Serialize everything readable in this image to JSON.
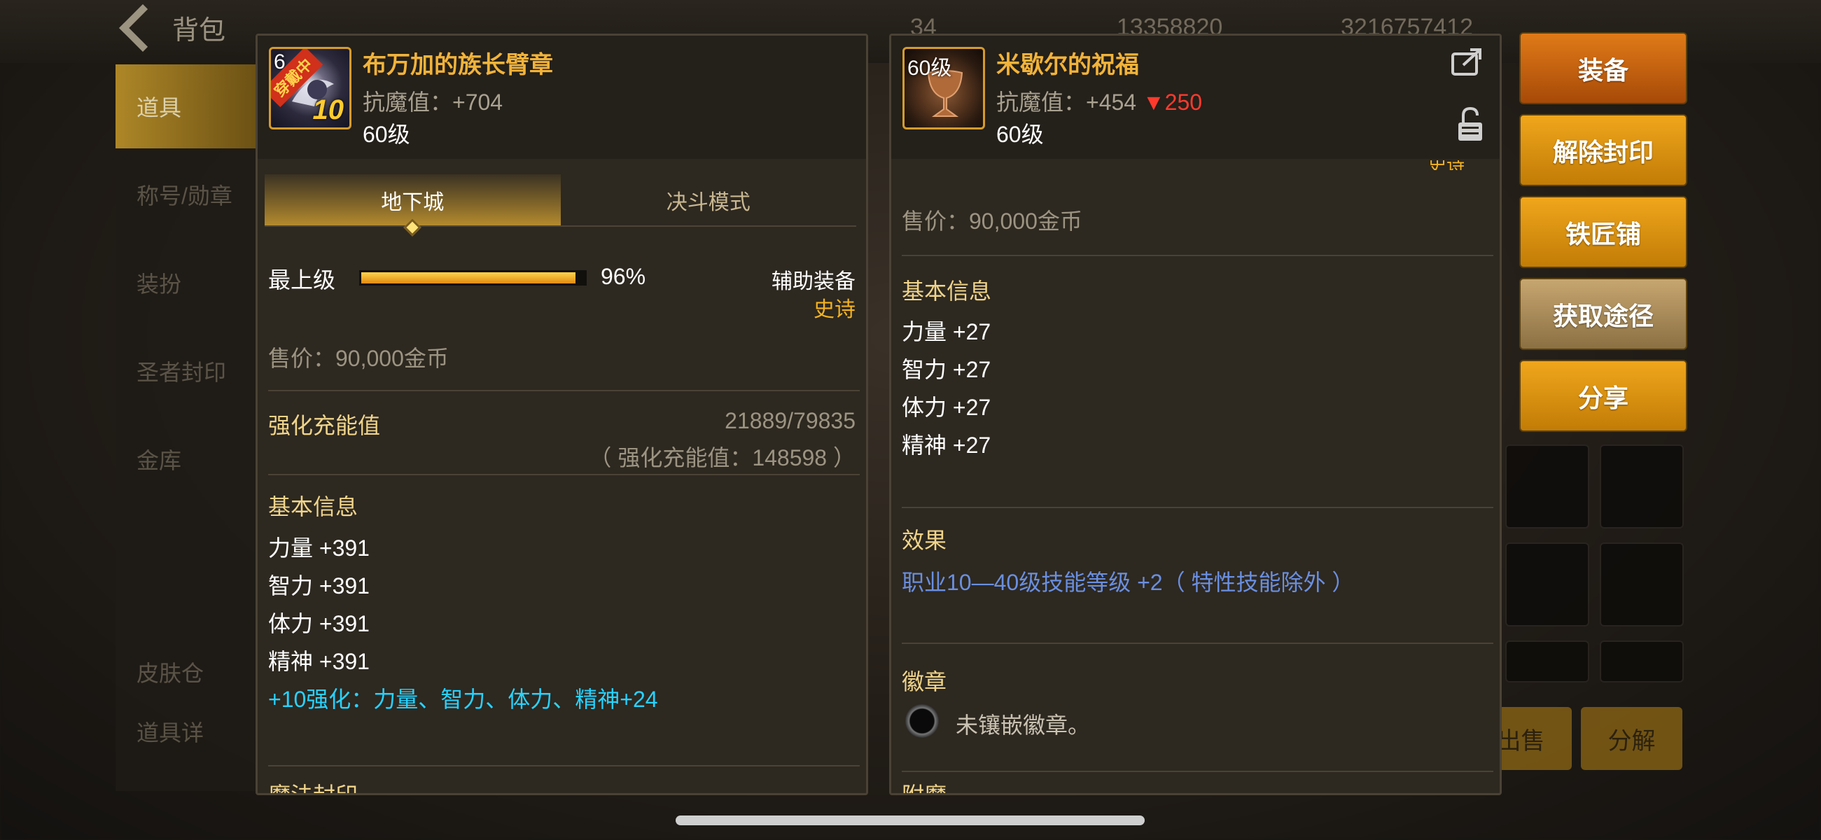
{
  "background": {
    "back_label": "背包",
    "top_stats": [
      "34",
      "13358820",
      "3216757412"
    ],
    "sidebar_items": [
      "道具",
      "称号/勋章",
      "装扮",
      "圣者封印",
      "金库"
    ],
    "bottom_labels": [
      "皮肤仓",
      "道具详"
    ],
    "bottom_buttons": [
      "出售",
      "分解"
    ]
  },
  "left_panel": {
    "icon": {
      "level_tag": "6",
      "equipped_badge": "穿戴中",
      "enhance": "10"
    },
    "name": "布万加的族长臂章",
    "stat": "抗魔值：+704",
    "level": "60级",
    "tabs": [
      {
        "label": "地下城",
        "active": true
      },
      {
        "label": "决斗模式",
        "active": false
      }
    ],
    "grade": {
      "label": "最上级",
      "percent": 96,
      "percent_text": "96%"
    },
    "category": "辅助装备",
    "rarity": "史诗",
    "price": "售价：90,000金币",
    "charge": {
      "label": "强化充能值",
      "value": "21889/79835",
      "total": "（ 强化充能值：148598 ）"
    },
    "basic_info_title": "基本信息",
    "stats": [
      "力量 +391",
      "智力 +391",
      "体力 +391",
      "精神 +391"
    ],
    "enhance_bonus": "+10强化：力量、智力、体力、精神+24",
    "cut_section": "魔法封印"
  },
  "right_panel": {
    "icon": {
      "level_tag": "60级"
    },
    "name": "米歇尔的祝福",
    "stat_prefix": "抗魔值：+454",
    "stat_diff": "▼250",
    "level": "60级",
    "cut_rarity": "史诗",
    "price": "售价：90,000金币",
    "basic_info_title": "基本信息",
    "stats": [
      "力量 +27",
      "智力 +27",
      "体力 +27",
      "精神 +27"
    ],
    "effect_title": "效果",
    "effect_text": "职业10—40级技能等级 +2（ 特性技能除外 ）",
    "badge_title": "徽章",
    "badge_text": "未镶嵌徽章。",
    "cut_section": "附魔"
  },
  "actions": [
    "装备",
    "解除封印",
    "铁匠铺",
    "获取途径",
    "分享"
  ],
  "colors": {
    "accent_gold": "#f2b33a",
    "stat_decrease": "#ff3a2d",
    "enhance_cyan": "#27d3ff",
    "effect_blue": "#6a8fe0",
    "equip_button": "#e07a18"
  }
}
